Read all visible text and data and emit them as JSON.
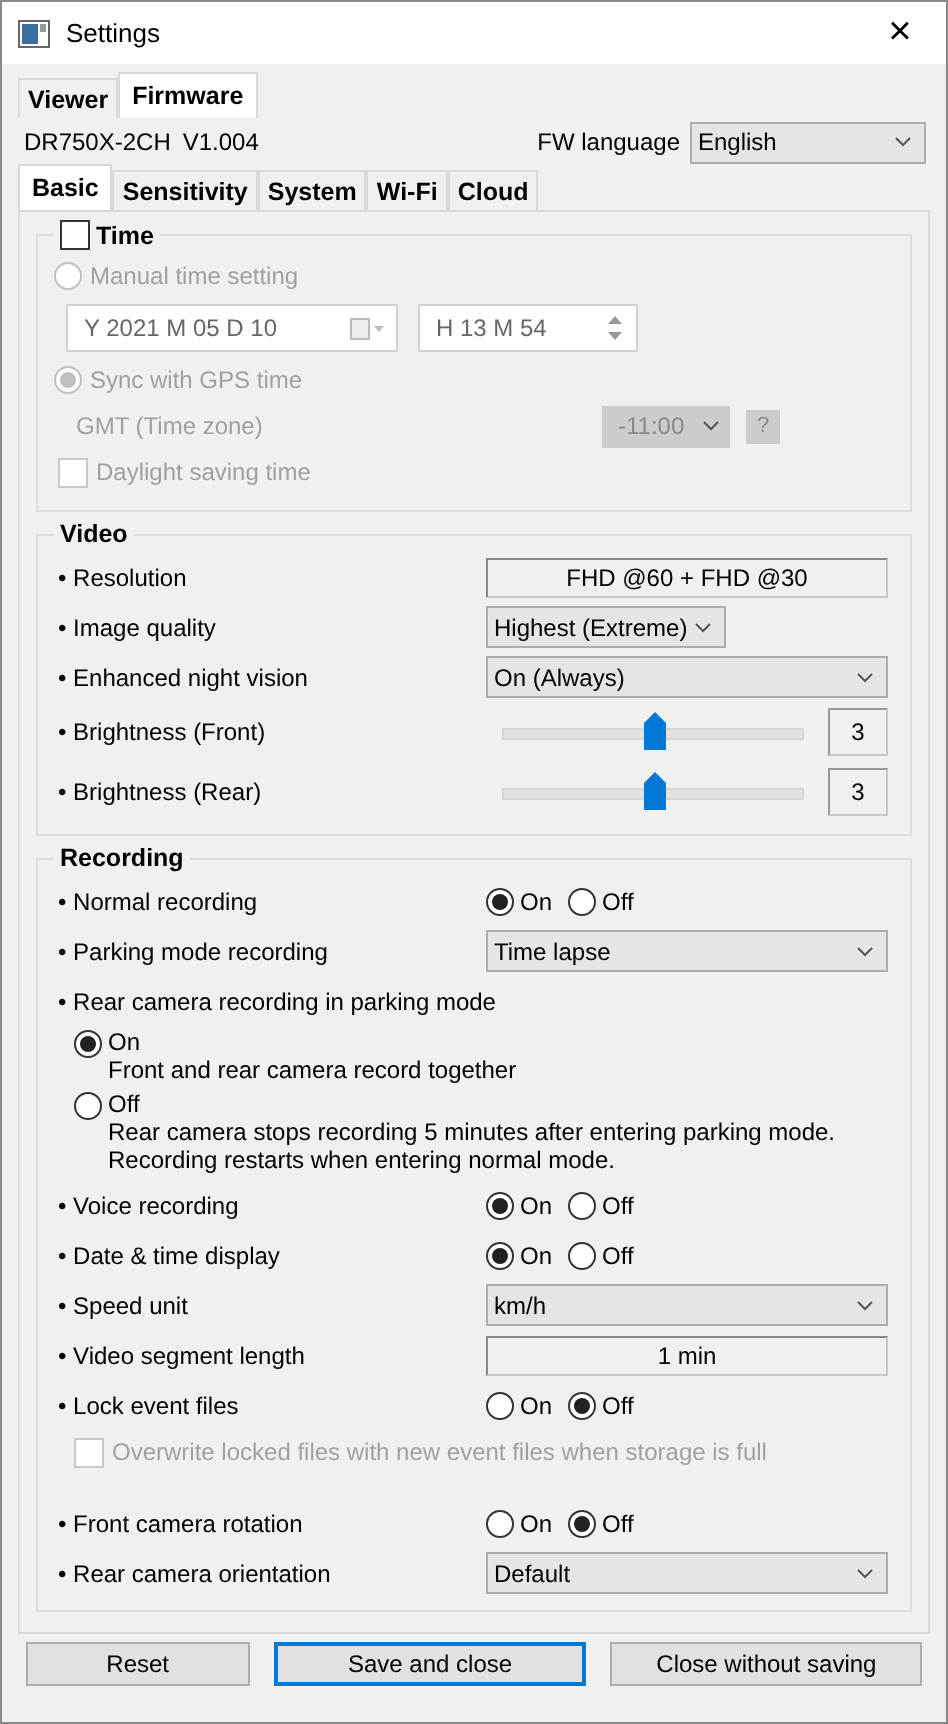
{
  "window": {
    "title": "Settings",
    "close": "×"
  },
  "top_tabs": [
    {
      "label": "Viewer",
      "selected": false
    },
    {
      "label": "Firmware",
      "selected": true
    }
  ],
  "device": {
    "model": "DR750X-2CH",
    "version": "V1.004",
    "language_label": "FW language",
    "language": "English"
  },
  "tabs": [
    {
      "label": "Basic",
      "selected": true
    },
    {
      "label": "Sensitivity",
      "selected": false
    },
    {
      "label": "System",
      "selected": false
    },
    {
      "label": "Wi-Fi",
      "selected": false
    },
    {
      "label": "Cloud",
      "selected": false
    }
  ],
  "time_group": {
    "label": "Time",
    "checked": false,
    "disabled": true,
    "manual": {
      "label": "Manual time setting",
      "selected": false,
      "date": "Y 2021 M 05 D 10",
      "time": "H 13 M 54"
    },
    "gps": {
      "label": "Sync with GPS time",
      "selected": true,
      "timezone_label": "GMT (Time zone)",
      "timezone": "-11:00",
      "help": "?"
    },
    "daylight": {
      "label": "Daylight saving time",
      "checked": false
    }
  },
  "groups": [
    {
      "title": "Video",
      "rows": [
        {
          "kind": "readonly",
          "label": "• Resolution",
          "value": "FHD @60 + FHD @30"
        },
        {
          "kind": "compact-select",
          "label": "• Image quality",
          "value": "Highest (Extreme)"
        },
        {
          "kind": "select",
          "label": "• Enhanced night vision",
          "value": "On (Always)"
        },
        {
          "kind": "slider",
          "label": "• Brightness (Front)",
          "level": 0.5,
          "value": "3"
        },
        {
          "kind": "slider",
          "label": "• Brightness (Rear)",
          "level": 0.5,
          "value": "3"
        }
      ]
    },
    {
      "title": "Recording",
      "rows": [
        {
          "kind": "on-off",
          "label": "• Normal recording",
          "options": [
            {
              "label": "On",
              "selected": true
            },
            {
              "label": "Off",
              "selected": false
            }
          ]
        },
        {
          "kind": "select",
          "label": "• Parking mode recording",
          "value": "Time lapse"
        },
        {
          "kind": "choice-block",
          "label": "• Rear camera recording in parking mode",
          "options": [
            {
              "label": "On",
              "description": "Front and rear camera record together",
              "selected": true
            },
            {
              "label": "Off",
              "description": "Rear camera stops recording 5 minutes after entering parking mode. Recording restarts when entering normal mode.",
              "selected": false
            }
          ]
        },
        {
          "kind": "on-off",
          "label": "• Voice recording",
          "options": [
            {
              "label": "On",
              "selected": true
            },
            {
              "label": "Off",
              "selected": false
            }
          ]
        },
        {
          "kind": "on-off",
          "label": "• Date & time display",
          "options": [
            {
              "label": "On",
              "selected": true
            },
            {
              "label": "Off",
              "selected": false
            }
          ]
        },
        {
          "kind": "select",
          "label": "• Speed unit",
          "value": "km/h"
        },
        {
          "kind": "readonly",
          "label": "• Video segment length",
          "value": "1 min"
        },
        {
          "kind": "on-off",
          "label": "• Lock event files",
          "options": [
            {
              "label": "On",
              "selected": false
            },
            {
              "label": "Off",
              "selected": true
            }
          ]
        },
        {
          "kind": "checkbox",
          "label": "Overwrite locked files with new event files when storage is full",
          "checked": false,
          "disabled": true
        },
        {
          "kind": "on-off",
          "label": "• Front camera rotation",
          "options": [
            {
              "label": "On",
              "selected": false
            },
            {
              "label": "Off",
              "selected": true
            }
          ]
        },
        {
          "kind": "select",
          "label": "• Rear camera orientation",
          "value": "Default"
        }
      ]
    }
  ],
  "buttons": [
    {
      "label": "Reset",
      "default": false
    },
    {
      "label": "Save and close",
      "default": true
    },
    {
      "label": "Close without saving",
      "default": false
    }
  ]
}
